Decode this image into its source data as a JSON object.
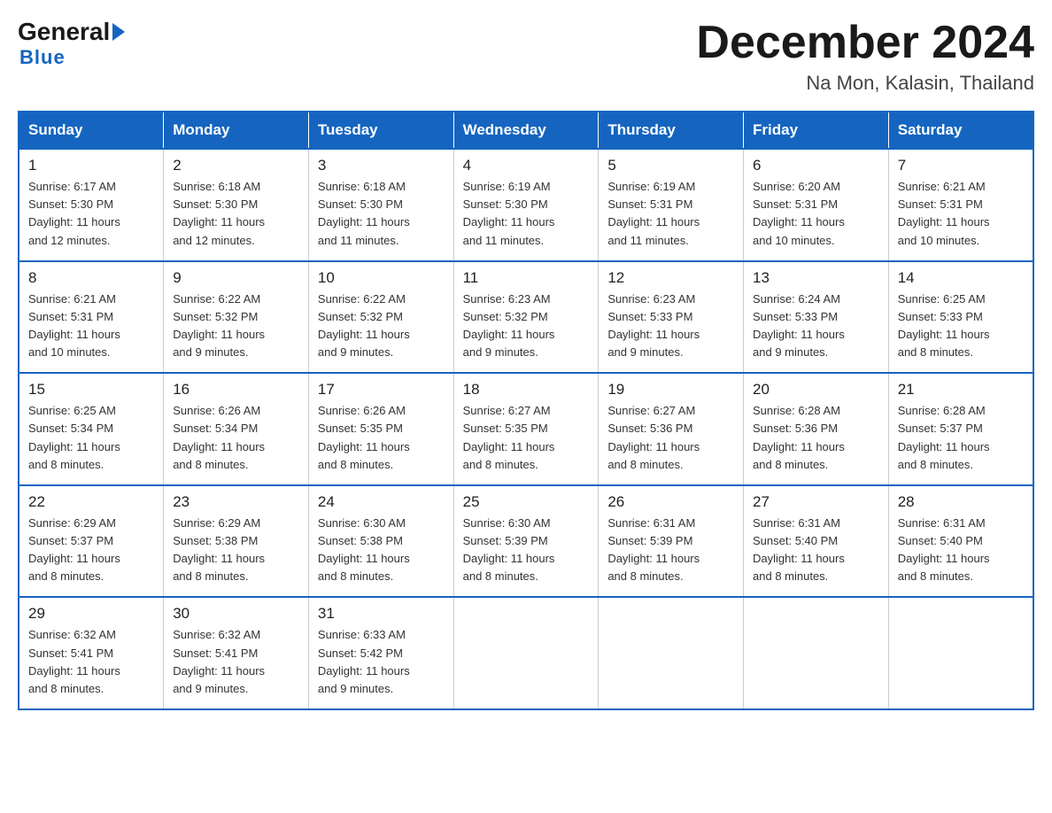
{
  "logo": {
    "general": "General",
    "blue": "Blue"
  },
  "header": {
    "month": "December 2024",
    "location": "Na Mon, Kalasin, Thailand"
  },
  "days_of_week": [
    "Sunday",
    "Monday",
    "Tuesday",
    "Wednesday",
    "Thursday",
    "Friday",
    "Saturday"
  ],
  "weeks": [
    [
      {
        "day": "1",
        "sunrise": "6:17 AM",
        "sunset": "5:30 PM",
        "daylight": "11 hours and 12 minutes."
      },
      {
        "day": "2",
        "sunrise": "6:18 AM",
        "sunset": "5:30 PM",
        "daylight": "11 hours and 12 minutes."
      },
      {
        "day": "3",
        "sunrise": "6:18 AM",
        "sunset": "5:30 PM",
        "daylight": "11 hours and 11 minutes."
      },
      {
        "day": "4",
        "sunrise": "6:19 AM",
        "sunset": "5:30 PM",
        "daylight": "11 hours and 11 minutes."
      },
      {
        "day": "5",
        "sunrise": "6:19 AM",
        "sunset": "5:31 PM",
        "daylight": "11 hours and 11 minutes."
      },
      {
        "day": "6",
        "sunrise": "6:20 AM",
        "sunset": "5:31 PM",
        "daylight": "11 hours and 10 minutes."
      },
      {
        "day": "7",
        "sunrise": "6:21 AM",
        "sunset": "5:31 PM",
        "daylight": "11 hours and 10 minutes."
      }
    ],
    [
      {
        "day": "8",
        "sunrise": "6:21 AM",
        "sunset": "5:31 PM",
        "daylight": "11 hours and 10 minutes."
      },
      {
        "day": "9",
        "sunrise": "6:22 AM",
        "sunset": "5:32 PM",
        "daylight": "11 hours and 9 minutes."
      },
      {
        "day": "10",
        "sunrise": "6:22 AM",
        "sunset": "5:32 PM",
        "daylight": "11 hours and 9 minutes."
      },
      {
        "day": "11",
        "sunrise": "6:23 AM",
        "sunset": "5:32 PM",
        "daylight": "11 hours and 9 minutes."
      },
      {
        "day": "12",
        "sunrise": "6:23 AM",
        "sunset": "5:33 PM",
        "daylight": "11 hours and 9 minutes."
      },
      {
        "day": "13",
        "sunrise": "6:24 AM",
        "sunset": "5:33 PM",
        "daylight": "11 hours and 9 minutes."
      },
      {
        "day": "14",
        "sunrise": "6:25 AM",
        "sunset": "5:33 PM",
        "daylight": "11 hours and 8 minutes."
      }
    ],
    [
      {
        "day": "15",
        "sunrise": "6:25 AM",
        "sunset": "5:34 PM",
        "daylight": "11 hours and 8 minutes."
      },
      {
        "day": "16",
        "sunrise": "6:26 AM",
        "sunset": "5:34 PM",
        "daylight": "11 hours and 8 minutes."
      },
      {
        "day": "17",
        "sunrise": "6:26 AM",
        "sunset": "5:35 PM",
        "daylight": "11 hours and 8 minutes."
      },
      {
        "day": "18",
        "sunrise": "6:27 AM",
        "sunset": "5:35 PM",
        "daylight": "11 hours and 8 minutes."
      },
      {
        "day": "19",
        "sunrise": "6:27 AM",
        "sunset": "5:36 PM",
        "daylight": "11 hours and 8 minutes."
      },
      {
        "day": "20",
        "sunrise": "6:28 AM",
        "sunset": "5:36 PM",
        "daylight": "11 hours and 8 minutes."
      },
      {
        "day": "21",
        "sunrise": "6:28 AM",
        "sunset": "5:37 PM",
        "daylight": "11 hours and 8 minutes."
      }
    ],
    [
      {
        "day": "22",
        "sunrise": "6:29 AM",
        "sunset": "5:37 PM",
        "daylight": "11 hours and 8 minutes."
      },
      {
        "day": "23",
        "sunrise": "6:29 AM",
        "sunset": "5:38 PM",
        "daylight": "11 hours and 8 minutes."
      },
      {
        "day": "24",
        "sunrise": "6:30 AM",
        "sunset": "5:38 PM",
        "daylight": "11 hours and 8 minutes."
      },
      {
        "day": "25",
        "sunrise": "6:30 AM",
        "sunset": "5:39 PM",
        "daylight": "11 hours and 8 minutes."
      },
      {
        "day": "26",
        "sunrise": "6:31 AM",
        "sunset": "5:39 PM",
        "daylight": "11 hours and 8 minutes."
      },
      {
        "day": "27",
        "sunrise": "6:31 AM",
        "sunset": "5:40 PM",
        "daylight": "11 hours and 8 minutes."
      },
      {
        "day": "28",
        "sunrise": "6:31 AM",
        "sunset": "5:40 PM",
        "daylight": "11 hours and 8 minutes."
      }
    ],
    [
      {
        "day": "29",
        "sunrise": "6:32 AM",
        "sunset": "5:41 PM",
        "daylight": "11 hours and 8 minutes."
      },
      {
        "day": "30",
        "sunrise": "6:32 AM",
        "sunset": "5:41 PM",
        "daylight": "11 hours and 9 minutes."
      },
      {
        "day": "31",
        "sunrise": "6:33 AM",
        "sunset": "5:42 PM",
        "daylight": "11 hours and 9 minutes."
      },
      null,
      null,
      null,
      null
    ]
  ],
  "labels": {
    "sunrise": "Sunrise:",
    "sunset": "Sunset:",
    "daylight": "Daylight:"
  }
}
